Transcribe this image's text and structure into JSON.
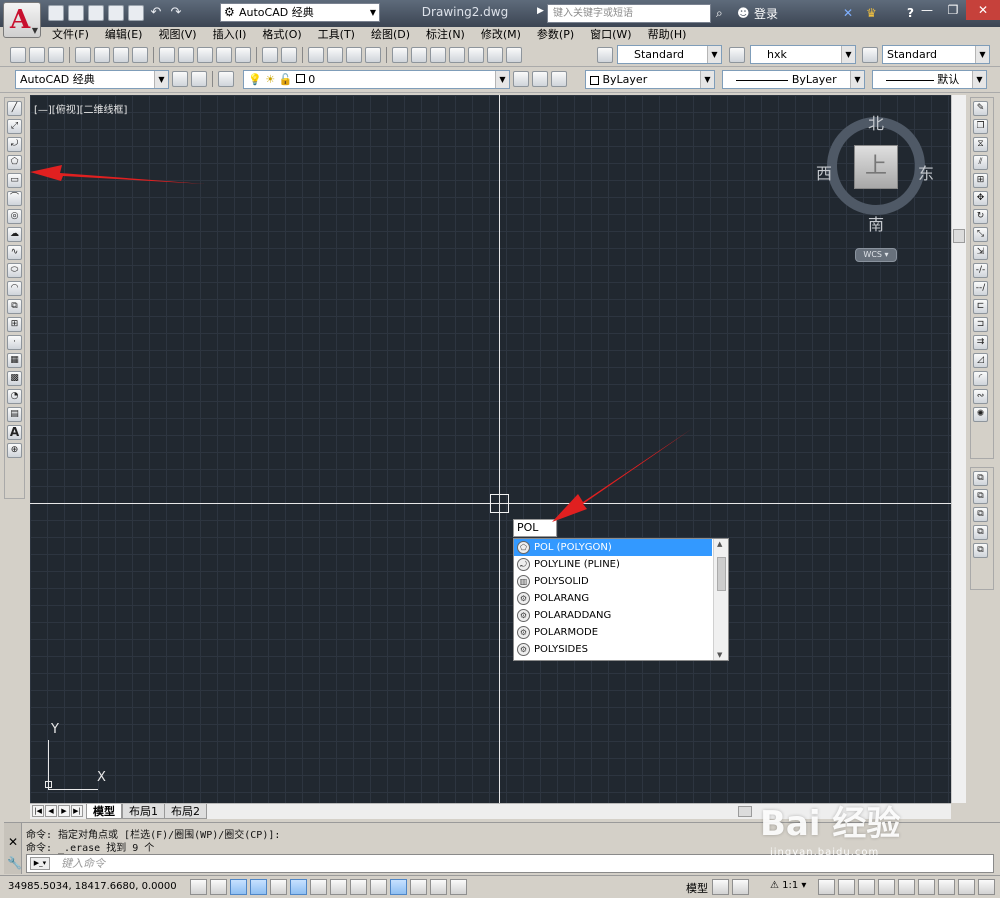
{
  "title_bar": {
    "workspace": "AutoCAD 经典",
    "document": "Drawing2.dwg",
    "search_placeholder": "键入关键字或短语",
    "login": "登录",
    "help": "?"
  },
  "menu": [
    "文件(F)",
    "编辑(E)",
    "视图(V)",
    "插入(I)",
    "格式(O)",
    "工具(T)",
    "绘图(D)",
    "标注(N)",
    "修改(M)",
    "参数(P)",
    "窗口(W)",
    "帮助(H)"
  ],
  "toolbar1": {
    "text_style": "Standard",
    "dim_style": "hxk",
    "table_style": "Standard"
  },
  "toolbar2": {
    "workspace": "AutoCAD 经典",
    "layer": "0",
    "color": "ByLayer",
    "linetype": "ByLayer",
    "lineweight": "默认"
  },
  "viewport": {
    "label": "[—][俯视][二维线框]"
  },
  "viewcube": {
    "top": "上",
    "north": "北",
    "south": "南",
    "east": "东",
    "west": "西",
    "wcs": "WCS"
  },
  "ucs": {
    "x": "X",
    "y": "Y"
  },
  "command_input": "POL",
  "autocomplete": [
    {
      "label": "POL (POLYGON)",
      "selected": true,
      "icon": "polygon-icon"
    },
    {
      "label": "POLYLINE (PLINE)",
      "selected": false,
      "icon": "polyline-icon"
    },
    {
      "label": "POLYSOLID",
      "selected": false,
      "icon": "polysolid-icon"
    },
    {
      "label": "POLARANG",
      "selected": false,
      "icon": "gear-icon"
    },
    {
      "label": "POLARADDANG",
      "selected": false,
      "icon": "gear-icon"
    },
    {
      "label": "POLARMODE",
      "selected": false,
      "icon": "gear-icon"
    },
    {
      "label": "POLYSIDES",
      "selected": false,
      "icon": "gear-icon"
    }
  ],
  "layout_tabs": [
    "模型",
    "布局1",
    "布局2"
  ],
  "command_history": [
    "命令: 指定对角点或 [栏选(F)/圈围(WP)/圈交(CP)]:",
    "命令: _.erase 找到 9 个"
  ],
  "command_placeholder": "键入命令",
  "status": {
    "coordinates": "34985.5034, 18417.6680, 0.0000",
    "model": "模型",
    "scale": "1:1"
  },
  "watermark": {
    "brand": "Bai 经验",
    "url": "jingyan.baidu.com"
  },
  "colors": {
    "canvas_bg": "#212830",
    "grid": "#2d3540",
    "selection": "#3399ff",
    "arrow": "#e02020"
  }
}
